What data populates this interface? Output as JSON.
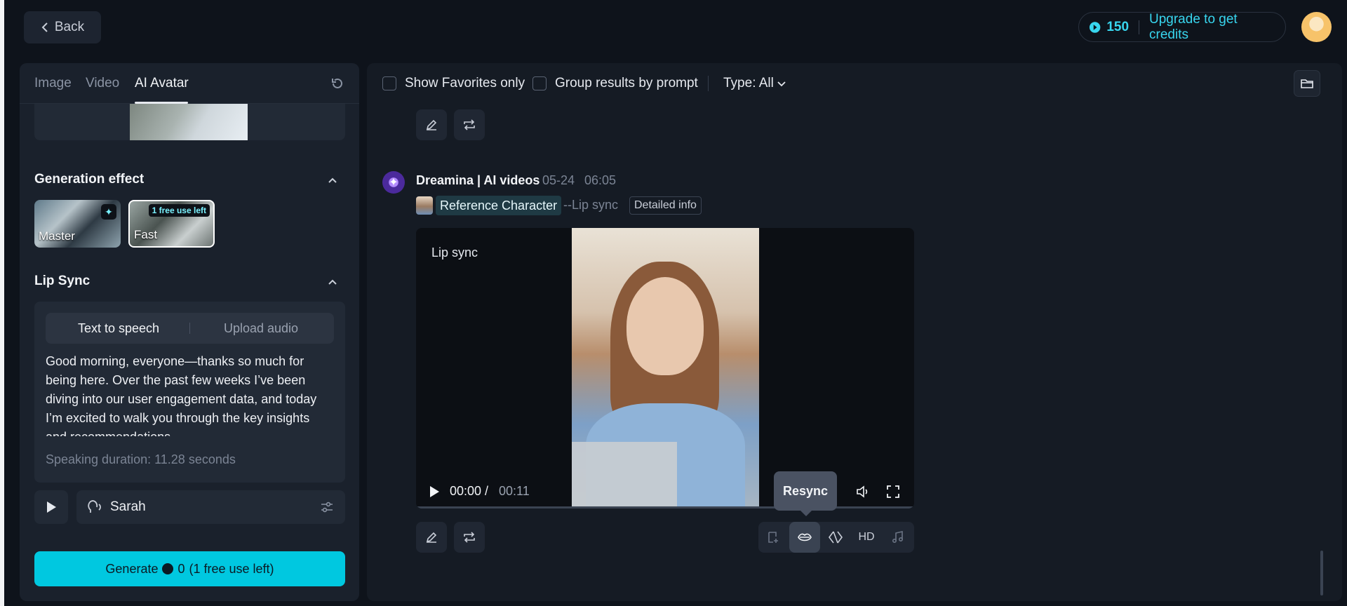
{
  "header": {
    "back_label": "Back",
    "credits": "150",
    "upgrade_label": "Upgrade to get credits"
  },
  "left": {
    "tabs": [
      "Image",
      "Video",
      "AI Avatar"
    ],
    "generation_effect": {
      "title": "Generation effect",
      "options": [
        {
          "label": "Master"
        },
        {
          "label": "Fast",
          "badge": "1 free use left"
        }
      ]
    },
    "lip_sync": {
      "title": "Lip Sync",
      "modes": [
        "Text to speech",
        "Upload audio"
      ],
      "script": "Good morning, everyone—thanks so much for being here. Over the past few weeks I’ve been diving into our user engagement data, and today I’m excited to walk you through the key insights and recommendations",
      "duration": "Speaking duration: 11.28 seconds"
    },
    "voice": {
      "name": "Sarah"
    },
    "generate": {
      "label": "Generate",
      "cost": "0",
      "note": "(1 free use left)"
    }
  },
  "right": {
    "filters": {
      "favorites_label": "Show Favorites only",
      "group_label": "Group results by prompt",
      "type_label": "Type: All"
    },
    "item": {
      "title": "Dreamina | AI videos",
      "date": "05-24",
      "time": "06:05",
      "reference_label": "Reference Character",
      "mode_tag": "--Lip sync",
      "detail_label": "Detailed info",
      "video_label": "Lip sync",
      "time_current": "00:00 /",
      "time_total": "00:11",
      "progress_fraction": 0,
      "tooltip": "Resync",
      "hd_label": "HD"
    }
  },
  "colors": {
    "accent": "#00c8e0",
    "credit_text": "#38d6ef",
    "background": "#0e131b"
  }
}
